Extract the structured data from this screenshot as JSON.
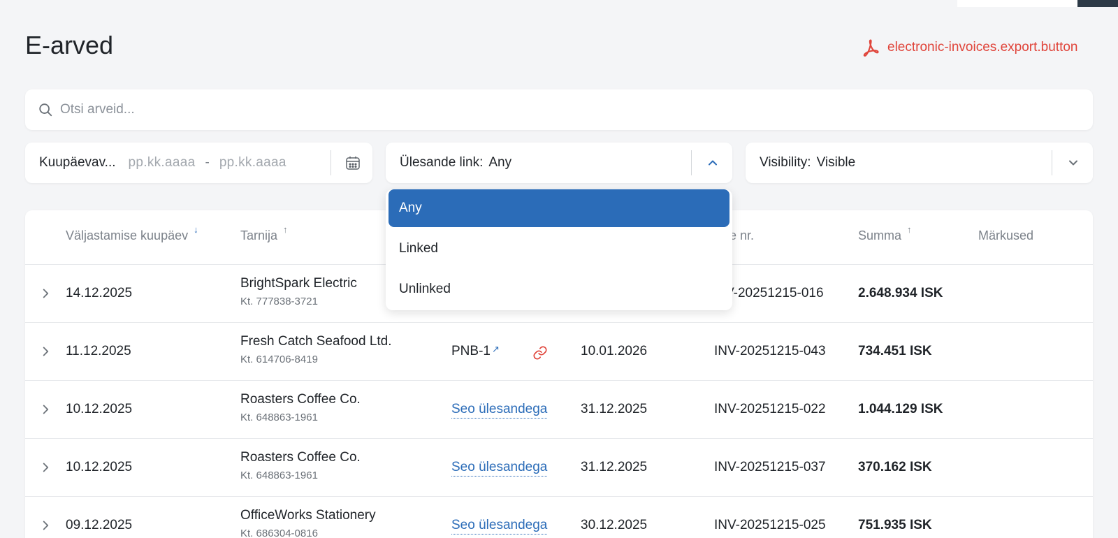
{
  "page": {
    "title": "E-arved"
  },
  "export_button": {
    "label": "electronic-invoices.export.button"
  },
  "search": {
    "placeholder": "Otsi arveid...",
    "value": ""
  },
  "filters": {
    "date_range": {
      "label": "Kuupäevav...",
      "from_placeholder": "pp.kk.aaaa",
      "separator": "-",
      "to_placeholder": "pp.kk.aaaa"
    },
    "task_link": {
      "label": "Ülesande link:",
      "value": "Any"
    },
    "visibility": {
      "label": "Visibility:",
      "value": "Visible"
    }
  },
  "task_link_dropdown": {
    "options": [
      "Any",
      "Linked",
      "Unlinked"
    ],
    "selected": "Any"
  },
  "table": {
    "columns": {
      "issue_date": "Väljastamise kuupäev",
      "supplier": "Tarnija",
      "invoice_number": "re nr.",
      "amount": "Summa",
      "notes": "Märkused"
    },
    "link_action": "Seo ülesandega",
    "rows": [
      {
        "date": "14.12.2025",
        "supplier": "BrightSpark Electric",
        "reg": "Kt. 777838-3721",
        "task": "",
        "due": "",
        "invoice": "V-20251215-016",
        "amount": "2.648.934 ISK"
      },
      {
        "date": "11.12.2025",
        "supplier": "Fresh Catch Seafood Ltd.",
        "reg": "Kt. 614706-8419",
        "task": "PNB-1",
        "due": "10.01.2026",
        "invoice": "INV-20251215-043",
        "amount": "734.451 ISK"
      },
      {
        "date": "10.12.2025",
        "supplier": "Roasters Coffee Co.",
        "reg": "Kt. 648863-1961",
        "task": "",
        "due": "31.12.2025",
        "invoice": "INV-20251215-022",
        "amount": "1.044.129 ISK"
      },
      {
        "date": "10.12.2025",
        "supplier": "Roasters Coffee Co.",
        "reg": "Kt. 648863-1961",
        "task": "",
        "due": "31.12.2025",
        "invoice": "INV-20251215-037",
        "amount": "370.162 ISK"
      },
      {
        "date": "09.12.2025",
        "supplier": "OfficeWorks Stationery",
        "reg": "Kt. 686304-0816",
        "task": "",
        "due": "30.12.2025",
        "invoice": "INV-20251215-025",
        "amount": "751.935 ISK"
      }
    ]
  },
  "icons": {
    "export": "pdf-icon",
    "search": "search-icon",
    "calendar": "calendar-icon",
    "expand": "chevron-right-icon",
    "external": "external-link-icon",
    "unlink": "chain-link-icon"
  },
  "colors": {
    "accent": "#2b6cb8",
    "danger": "#e0443a",
    "background": "#f4f5f7"
  }
}
